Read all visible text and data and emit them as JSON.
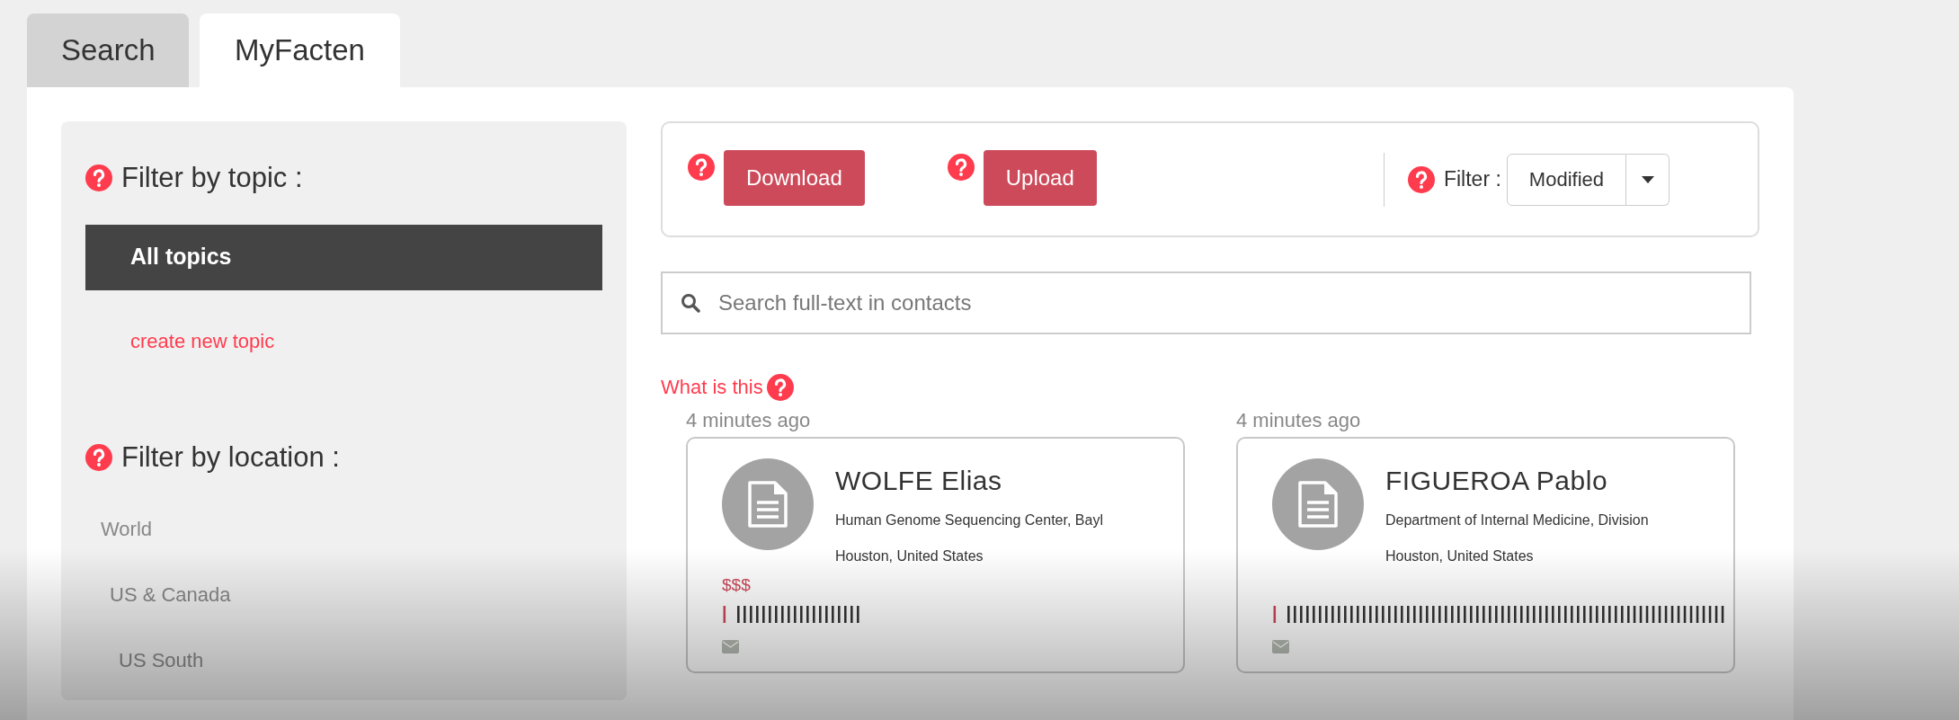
{
  "tabs": [
    {
      "label": "Search",
      "selected": false
    },
    {
      "label": "MyFacten",
      "selected": true
    }
  ],
  "sidebar": {
    "topic_heading": "Filter by topic :",
    "topics": [
      {
        "label": "All topics",
        "selected": true
      }
    ],
    "create_topic_link": "create new topic",
    "location_heading": "Filter by location :",
    "locations": [
      {
        "label": "World",
        "children": [
          {
            "label": "US & Canada",
            "children": [
              {
                "label": "US South"
              }
            ]
          }
        ]
      }
    ]
  },
  "toolbar": {
    "buttons": [
      {
        "label": "Download"
      },
      {
        "label": "Upload"
      }
    ],
    "filter": {
      "label": "Filter :",
      "value": "Modified"
    }
  },
  "search": {
    "placeholder": "Search full-text in contacts"
  },
  "help_link": "What is this",
  "contacts": [
    {
      "time": "4 minutes ago",
      "name": "WOLFE Elias",
      "affiliation": "Human Genome Sequencing Center, Bayl",
      "location": "Houston, United States",
      "price": "$$$",
      "marker": "|",
      "ticks": "||||||||||||||||||||"
    },
    {
      "time": "4 minutes ago",
      "name": "FIGUEROA Pablo",
      "affiliation": "Department of Internal Medicine, Division",
      "location": "Houston, United States",
      "marker": "|",
      "ticks": "||||||||||||||||||||||||||||||||||||||||||||||||||||||||||||||||||||||"
    }
  ]
}
